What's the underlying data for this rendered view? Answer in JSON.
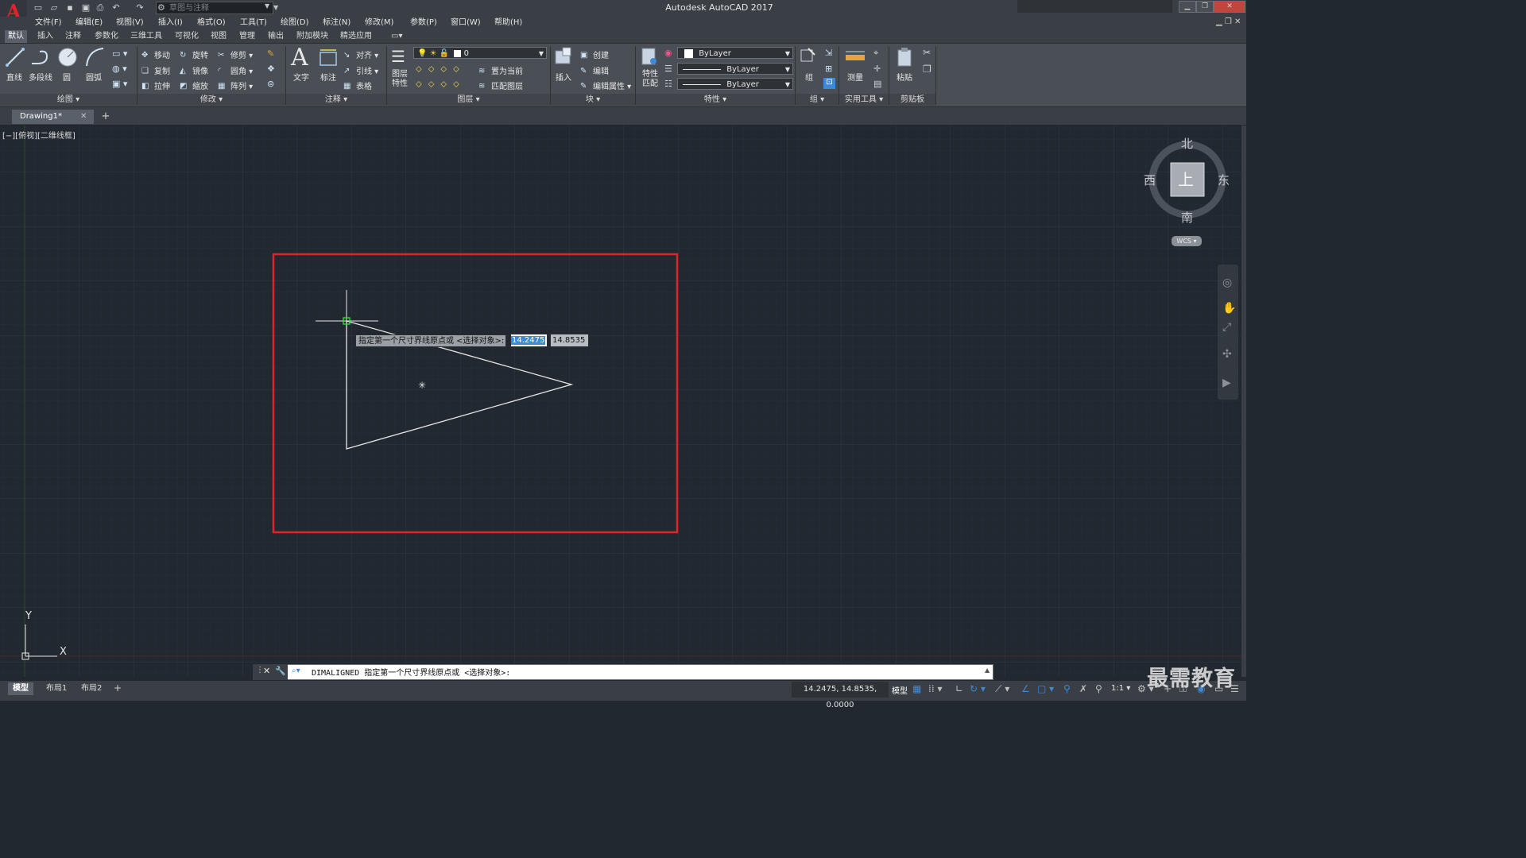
{
  "app": {
    "window_title": "Autodesk AutoCAD 2017",
    "workspace": "草图与注释",
    "logo": "A"
  },
  "menus": [
    "文件(F)",
    "编辑(E)",
    "视图(V)",
    "插入(I)",
    "格式(O)",
    "工具(T)",
    "绘图(D)",
    "标注(N)",
    "修改(M)",
    "参数(P)",
    "窗口(W)",
    "帮助(H)"
  ],
  "ribbon_tabs": [
    "默认",
    "插入",
    "注释",
    "参数化",
    "三维工具",
    "可视化",
    "视图",
    "管理",
    "输出",
    "附加模块",
    "精选应用"
  ],
  "draw_panel": {
    "title": "绘图",
    "tools": [
      "直线",
      "多段线",
      "圆",
      "圆弧"
    ]
  },
  "modify_panel": {
    "title": "修改",
    "row1": [
      "移动",
      "旋转",
      "修剪"
    ],
    "row2": [
      "复制",
      "镜像",
      "圆角"
    ],
    "row3": [
      "拉伸",
      "缩放",
      "阵列"
    ]
  },
  "annotation_panel": {
    "title": "注释",
    "text": "文字",
    "dimension": "标注",
    "linear": "对齐",
    "leader": "引线",
    "table": "表格"
  },
  "layers_panel": {
    "title": "图层",
    "layer_props": "图层\n特性",
    "current_layer": "0",
    "set_current": "置为当前",
    "match_layer": "匹配图层"
  },
  "block_panel": {
    "title": "块",
    "insert": "插入",
    "create": "创建",
    "edit": "编辑",
    "edit_attr": "编辑属性"
  },
  "properties_panel": {
    "title": "特性",
    "match": "特性\n匹配",
    "color": "ByLayer",
    "linetype": "ByLayer",
    "lineweight": "ByLayer"
  },
  "groups_panel": {
    "title": "组",
    "group": "组"
  },
  "utilities_panel": {
    "title": "实用工具",
    "measure": "测量"
  },
  "clipboard_panel": {
    "title": "剪贴板",
    "paste": "粘贴"
  },
  "file_tab": {
    "name": "Drawing1*"
  },
  "viewport_label": "[−][俯视][二维线框]",
  "dynamic_input": {
    "prompt": "指定第一个尺寸界线原点或 <选择对象>:",
    "x_value": "14.2475",
    "y_value": "14.8535"
  },
  "viewcube": {
    "north": "北",
    "south": "南",
    "east": "东",
    "west": "西",
    "top": "上",
    "wcs": "WCS"
  },
  "ucs": {
    "x": "X",
    "y": "Y"
  },
  "command_line": {
    "text": "DIMALIGNED 指定第一个尺寸界线原点或 <选择对象>:"
  },
  "layout_tabs": [
    "模型",
    "布局1",
    "布局2"
  ],
  "status": {
    "coordinates": "14.2475, 14.8535, 0.0000",
    "model_label": "模型",
    "scale": "1:1"
  },
  "watermark": "最需教育",
  "colors": {
    "canvas_bg": "#212830",
    "highlight_box": "#e0242b",
    "ribbon_bg": "#4a4f56",
    "accent": "#3d8ad8"
  }
}
